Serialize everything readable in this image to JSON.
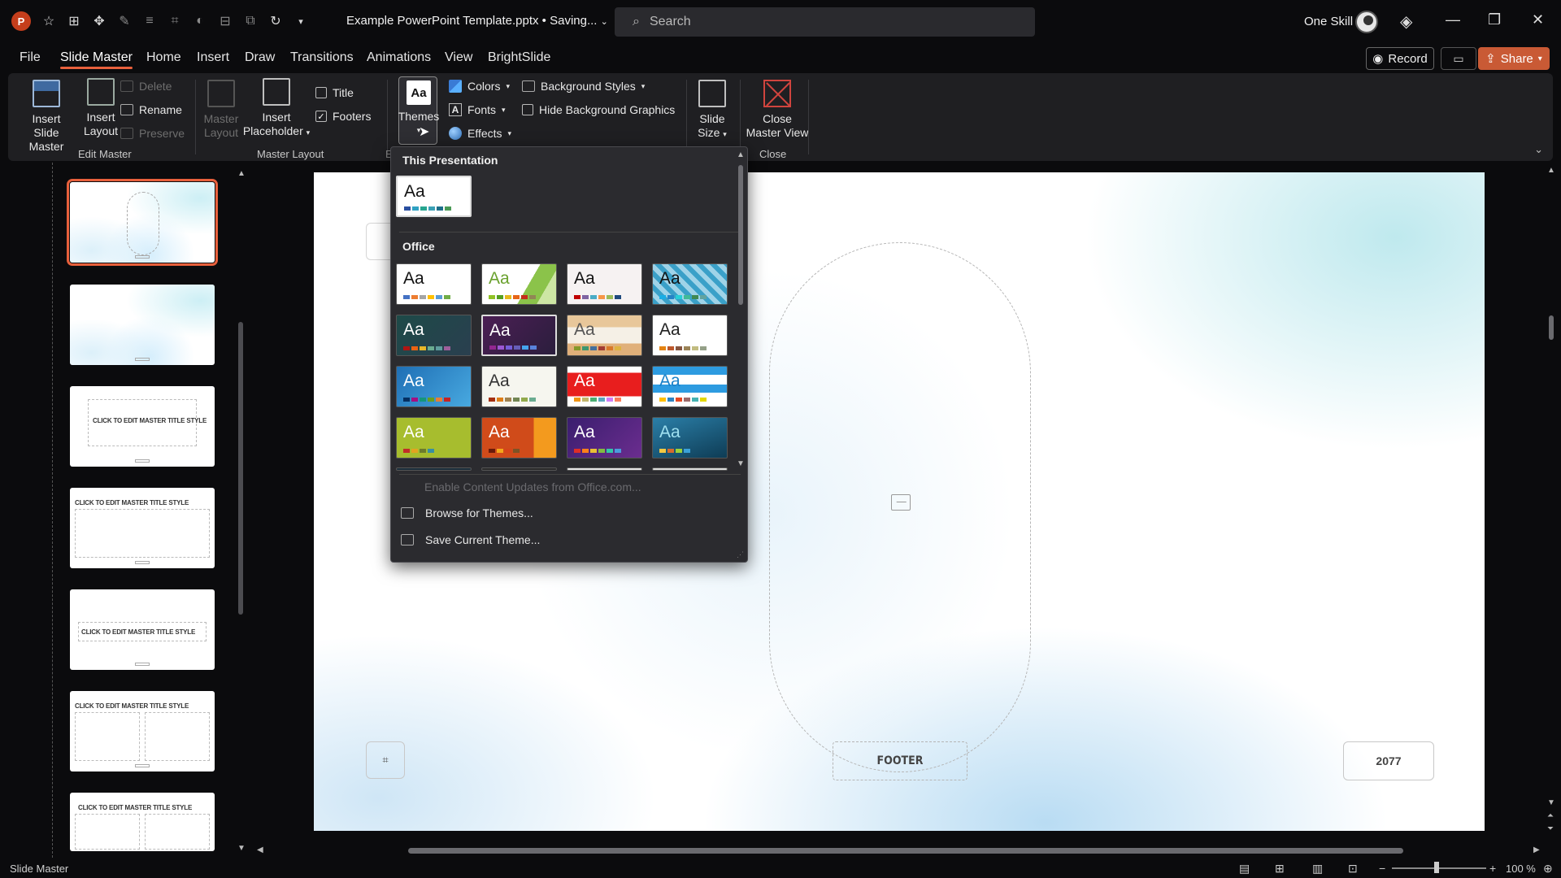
{
  "app": {
    "doc_title": "Example PowerPoint Template.pptx • Saving...",
    "user_name": "One Skill",
    "logo_letter": "P",
    "search_placeholder": "Search"
  },
  "menu": {
    "tabs": [
      "File",
      "Slide Master",
      "Home",
      "Insert",
      "Draw",
      "Transitions",
      "Animations",
      "View",
      "BrightSlide"
    ],
    "active_tab": "Slide Master",
    "record_label": "Record",
    "share_label": "Share"
  },
  "ribbon": {
    "insert_slide_master": [
      "Insert Slide",
      "Master"
    ],
    "insert_layout": [
      "Insert",
      "Layout"
    ],
    "delete": "Delete",
    "rename": "Rename",
    "preserve": "Preserve",
    "edit_master_group": "Edit Master",
    "master_layout": [
      "Master",
      "Layout"
    ],
    "insert_placeholder": [
      "Insert",
      "Placeholder"
    ],
    "title_check": "Title",
    "title_checked": false,
    "footers_check": "Footers",
    "footers_checked": true,
    "master_layout_group": "Master Layout",
    "themes": "Themes",
    "colors": "Colors",
    "fonts": "Fonts",
    "effects": "Effects",
    "background_styles": "Background Styles",
    "hide_bg_graphics": "Hide Background Graphics",
    "hide_bg_checked": false,
    "slide_size": [
      "Slide",
      "Size"
    ],
    "close_master_view": [
      "Close",
      "Master View"
    ],
    "close_group": "Close",
    "partial_group_letter": "E"
  },
  "themes_dropdown": {
    "section_this_presentation": "This Presentation",
    "section_office": "Office",
    "tile_label": "Aa",
    "enable_updates": "Enable Content Updates from Office.com...",
    "browse": "Browse for Themes...",
    "save_current": "Save Current Theme..."
  },
  "thumbnails": {
    "title_text": "CLICK TO EDIT MASTER TITLE STYLE",
    "count": 7,
    "selected_index": 0
  },
  "slide": {
    "footer": "FOOTER",
    "date": "2077",
    "slide_number_icon": "slide-number-icon"
  },
  "status": {
    "mode": "Slide Master",
    "zoom": "100 %"
  },
  "colors": {
    "accent_orange": "#e8603c",
    "share_bg": "#c95a35",
    "ppt_red": "#c43e1c"
  }
}
